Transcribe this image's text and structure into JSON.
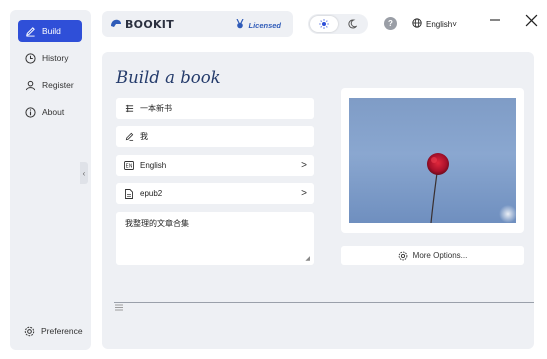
{
  "sidebar": {
    "items": [
      {
        "label": "Build",
        "icon": "pencil-icon",
        "active": true
      },
      {
        "label": "History",
        "icon": "clock-icon",
        "active": false
      },
      {
        "label": "Register",
        "icon": "user-icon",
        "active": false
      },
      {
        "label": "About",
        "icon": "info-icon",
        "active": false
      }
    ],
    "preference_label": "Preference",
    "collapse_glyph": "‹"
  },
  "header": {
    "logo_text": "BOOKIT",
    "licensed_label": "Licensed",
    "help_glyph": "?",
    "language": "English",
    "language_caret": "˅"
  },
  "main": {
    "title": "Build a book",
    "fields": [
      {
        "value": "一本新书",
        "icon": "book-title-icon",
        "has_chevron": false
      },
      {
        "value": "我",
        "icon": "author-pen-icon",
        "has_chevron": false
      },
      {
        "value": "English",
        "icon": "language-icon",
        "has_chevron": true
      },
      {
        "value": "epub2",
        "icon": "file-format-icon",
        "has_chevron": true
      }
    ],
    "chevron_glyph": ">",
    "description": "我整理的文章合集",
    "more_options_label": "More Options..."
  },
  "colors": {
    "accent": "#2f4fd8",
    "panel": "#eef0f4",
    "title": "#243b6b",
    "licensed": "#2f5bb8"
  }
}
